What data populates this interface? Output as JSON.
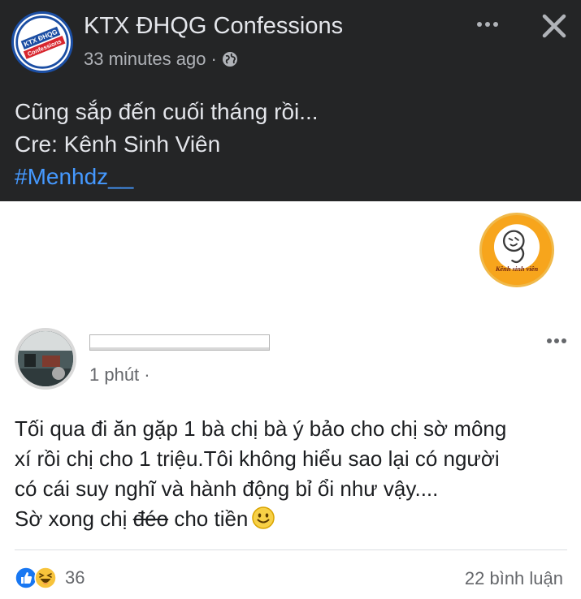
{
  "post": {
    "page_name": "KTX ĐHQG Confessions",
    "time": "33 minutes ago",
    "separator": "·",
    "lines": [
      "Cũng sắp đến cuối tháng rồi...",
      "Cre: Kênh Sinh Viên"
    ],
    "hashtag": "#Menhdz__",
    "hashtag_color": "#4599ff",
    "background_color": "#242526"
  },
  "page_logo": {
    "text_top": "KTX ĐHQG",
    "text_bottom": "Confessions"
  },
  "shared_image": {
    "logo_text": "Kênh sinh viên",
    "logo_color": "#f7a51c",
    "inner_post": {
      "time": "1 phút",
      "separator": "·",
      "lines": [
        "Tối qua đi ăn gặp 1 bà chị bà ý bảo cho chị sờ mông",
        "xí rồi chị cho 1 triệu.Tôi không hiểu sao lại có người",
        "có cái suy nghĩ và hành động bỉ ổi như vậy...."
      ],
      "last_line_prefix": "Sờ xong chị",
      "struck_word": "đéo",
      "last_line_suffix": "cho tiền",
      "emoji": "smile-emoji",
      "reaction_count": "36",
      "comment_count": "22 bình luận"
    }
  },
  "icons": {
    "close": "close-icon",
    "more": "more-options-icon",
    "globe": "globe-icon",
    "like": "like-icon",
    "haha": "haha-icon"
  }
}
